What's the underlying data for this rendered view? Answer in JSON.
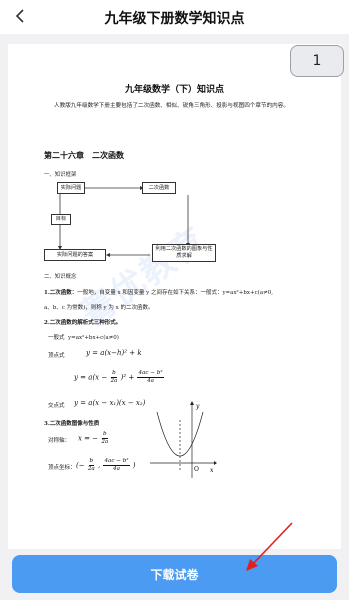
{
  "header": {
    "title": "九年级下册数学知识点",
    "back_icon": "chevron-left-icon"
  },
  "badge": {
    "page_number": "1"
  },
  "document": {
    "title": "九年级数学（下）知识点",
    "intro": "人教版九年级数学下册主要包括了二次函数、相似、锐角三角形、投影与视图四个章节的内容。",
    "chapter": "第二十六章　二次函数",
    "section1": "一、知识框架",
    "flow": {
      "box_problem": "实际问题",
      "box_quadfunc": "二次函数",
      "box_goal": "目标",
      "box_answer": "实际问题的答案",
      "box_solve": "利用二次函数的图象与性质求解"
    },
    "section2": "二、知识概念",
    "c1_title": "1.二次函数：",
    "c1_text": "一般地，自变量 x 和因变量 y 之间存在如下关系：一般式：y=ax²+bx+c(a≠0,",
    "c1_text2": "a、b、c 为常数)，则称 y 为 x 的二次函数。",
    "c2_title": "2.二次函数的解析式三种形式。",
    "general_label": "一般式",
    "general_formula": "y=ax²+bx+c(a≠0)",
    "vertex_label": "顶点式",
    "vertex_formula": "y = a(x−h)² + k",
    "vertex_formula2_a": "y = a(x −",
    "vertex_formula2_frac1_num": "b",
    "vertex_formula2_frac1_den": "2a",
    "vertex_formula2_b": ")² +",
    "vertex_formula2_frac2_num": "4ac − b²",
    "vertex_formula2_frac2_den": "4a",
    "intercept_label": "交点式",
    "intercept_formula": "y = a(x − x₁)(x − x₂)",
    "c3_title": "3.二次函数图像与性质",
    "axis_label": "对称轴：",
    "axis_formula_a": "x = −",
    "axis_frac_num": "b",
    "axis_frac_den": "2a",
    "vertex_coord_label": "顶点坐标：",
    "vertex_coord_a": "(−",
    "vertex_coord_frac1_num": "b",
    "vertex_coord_frac1_den": "2a",
    "vertex_coord_comma": ",",
    "vertex_coord_frac2_num": "4ac − b²",
    "vertex_coord_frac2_den": "4a",
    "vertex_coord_close": ")",
    "graph_label_y": "y",
    "graph_label_x": "x",
    "graph_label_o": "O"
  },
  "watermark": "菁优教育",
  "footer": {
    "download_label": "下载试卷"
  },
  "colors": {
    "primary": "#4a9bf1",
    "annotation_arrow": "#e02020"
  }
}
